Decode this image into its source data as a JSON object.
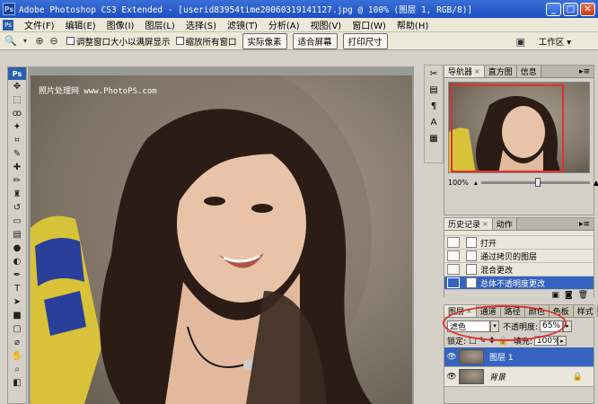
{
  "window": {
    "app_badge": "Ps",
    "title": "Adobe Photoshop CS3 Extended - [userid83954time20060319141127.jpg @ 100% (图层 1, RGB/8)]",
    "min": "_",
    "max": "□",
    "close": "✕"
  },
  "menu": [
    "文件(F)",
    "编辑(E)",
    "图像(I)",
    "图层(L)",
    "选择(S)",
    "滤镜(T)",
    "分析(A)",
    "视图(V)",
    "窗口(W)",
    "帮助(H)"
  ],
  "options_bar": {
    "check1": "调整窗口大小以满屏显示",
    "check2": "缩放所有窗口",
    "btn_actual": "实际像素",
    "btn_fit": "适合屏幕",
    "btn_print": "打印尺寸",
    "workspace": "工作区 ▾"
  },
  "canvas": {
    "watermark": "照片处理网 www.PhotoPS.com"
  },
  "navigator": {
    "tabs": [
      "导航器",
      "直方图",
      "信息"
    ],
    "zoom": "100%"
  },
  "history": {
    "tabs": [
      "历史记录",
      "动作"
    ],
    "items": [
      "打开",
      "通过拷贝的图层",
      "混合更改",
      "总体不透明度更改"
    ]
  },
  "layers": {
    "tabs": [
      "图层",
      "通道",
      "路径",
      "颜色",
      "色板",
      "样式"
    ],
    "blend_mode": "滤色",
    "opacity_label": "不透明度:",
    "opacity_value": "65%",
    "lock_label": "锁定:",
    "fill_label": "填充:",
    "fill_value": "100%",
    "items": [
      "图层 1",
      "背景"
    ]
  },
  "colors": {
    "titlebar": "#1c4fc0",
    "highlight": "#3563c0",
    "annotation": "#e03030"
  }
}
